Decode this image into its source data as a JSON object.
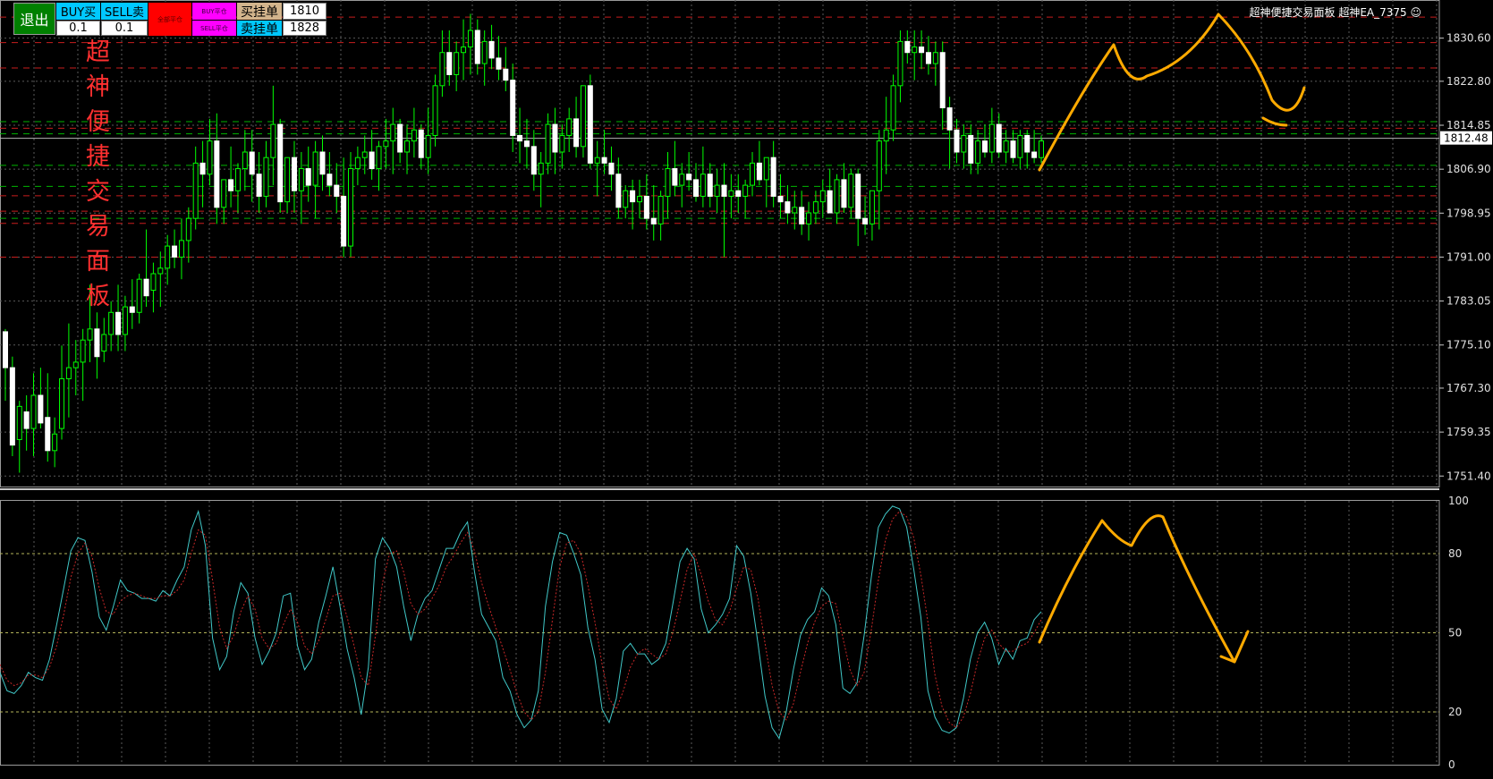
{
  "panel": {
    "exit_label": "退出",
    "buy_label": "BUY买",
    "sell_label": "SELL卖",
    "close_all_label": "全部平仓",
    "buy_close_label": "BUY平仓",
    "sell_close_label": "SELL平仓",
    "buy_pending_label": "买挂单",
    "sell_pending_label": "卖挂单",
    "buy_lot": "0.1",
    "sell_lot": "0.1",
    "buy_pending_price": "1810",
    "sell_pending_price": "1828",
    "title": "超神便捷交易面板"
  },
  "ea_title": "超神便捷交易面板 超神EA_7375",
  "colors": {
    "background": "#000000",
    "grid": "#5a5a5a",
    "candle": "#00ff00",
    "red_line": "#c81e1e",
    "green_line": "#00b400",
    "stoch_main": "#40c8c8",
    "stoch_signal": "#c82828",
    "annotation": "#ffaa00",
    "exit_button": "#008000",
    "buy_button": "#00c8ff",
    "close_all_button": "#ff0000",
    "close_side_button": "#ff00ff",
    "pending_button": "#d2b48c",
    "title_text": "#ff3030"
  },
  "chart_data": [
    {
      "type": "candlestick",
      "yticks": [
        "1830.60",
        "1822.80",
        "1814.85",
        "1806.90",
        "1798.95",
        "1791.00",
        "1783.05",
        "1775.10",
        "1767.30",
        "1759.35",
        "1751.40"
      ],
      "ylim": [
        1749.5,
        1837.5
      ],
      "current_price": "1812.48",
      "hlines_red": [
        1834.4,
        1829.8,
        1825.2,
        1814.3,
        1802.1,
        1799.3,
        1797.1,
        1791.0
      ],
      "hlines_green": [
        1815.5,
        1813.3,
        1807.6,
        1803.8,
        1798.0
      ],
      "candles": [
        [
          1777.5,
          1778,
          1765,
          1771
        ],
        [
          1771,
          1773,
          1755,
          1757
        ],
        [
          1758,
          1765,
          1752,
          1764
        ],
        [
          1763,
          1766,
          1756,
          1760
        ],
        [
          1760,
          1770,
          1755,
          1766
        ],
        [
          1766,
          1771,
          1760,
          1761
        ],
        [
          1762,
          1770,
          1754,
          1756
        ],
        [
          1756,
          1762,
          1753,
          1759
        ],
        [
          1760,
          1775,
          1758,
          1769
        ],
        [
          1769,
          1779,
          1762,
          1771
        ],
        [
          1771,
          1776,
          1766,
          1772
        ],
        [
          1772,
          1778,
          1765,
          1776
        ],
        [
          1776,
          1786,
          1772,
          1778
        ],
        [
          1778,
          1781,
          1769,
          1773
        ],
        [
          1774,
          1780,
          1772,
          1777
        ],
        [
          1777,
          1783,
          1774,
          1781
        ],
        [
          1781,
          1786,
          1774,
          1777
        ],
        [
          1777,
          1784,
          1774,
          1782
        ],
        [
          1782,
          1787,
          1778,
          1781
        ],
        [
          1781,
          1788,
          1779,
          1787
        ],
        [
          1787,
          1796,
          1782,
          1784
        ],
        [
          1785,
          1790,
          1781,
          1788
        ],
        [
          1788,
          1792,
          1782,
          1789
        ],
        [
          1789,
          1795,
          1786,
          1793
        ],
        [
          1793,
          1796,
          1789,
          1791
        ],
        [
          1791,
          1798,
          1787,
          1794
        ],
        [
          1794,
          1800,
          1790,
          1798
        ],
        [
          1798,
          1811,
          1796,
          1808
        ],
        [
          1808,
          1812,
          1800,
          1806
        ],
        [
          1806,
          1816,
          1804,
          1812
        ],
        [
          1812,
          1817,
          1797,
          1800
        ],
        [
          1800,
          1805,
          1797,
          1805
        ],
        [
          1805,
          1811,
          1800,
          1803
        ],
        [
          1803,
          1808,
          1799,
          1807
        ],
        [
          1807,
          1814,
          1803,
          1810
        ],
        [
          1810,
          1814,
          1801,
          1806
        ],
        [
          1806,
          1810,
          1799,
          1802
        ],
        [
          1802,
          1812,
          1800,
          1809
        ],
        [
          1809,
          1822,
          1804,
          1815
        ],
        [
          1815,
          1816,
          1799,
          1801
        ],
        [
          1801,
          1808,
          1799,
          1809
        ],
        [
          1809,
          1812,
          1799,
          1803
        ],
        [
          1803,
          1810,
          1797,
          1807
        ],
        [
          1807,
          1811,
          1801,
          1804
        ],
        [
          1804,
          1812,
          1798,
          1810
        ],
        [
          1810,
          1813,
          1803,
          1806
        ],
        [
          1806,
          1810,
          1802,
          1804
        ],
        [
          1804,
          1808,
          1799,
          1802
        ],
        [
          1802,
          1809,
          1791,
          1793
        ],
        [
          1793,
          1810,
          1791,
          1807
        ],
        [
          1807,
          1811,
          1804,
          1809
        ],
        [
          1809,
          1813,
          1806,
          1810
        ],
        [
          1810,
          1814,
          1805,
          1807
        ],
        [
          1807,
          1812,
          1803,
          1811
        ],
        [
          1811,
          1816,
          1807,
          1812
        ],
        [
          1812,
          1818,
          1806,
          1815
        ],
        [
          1815,
          1816,
          1808,
          1810
        ],
        [
          1810,
          1815,
          1806,
          1812
        ],
        [
          1812,
          1818,
          1809,
          1814
        ],
        [
          1814,
          1815,
          1807,
          1809
        ],
        [
          1809,
          1818,
          1806,
          1813
        ],
        [
          1813,
          1824,
          1811,
          1822
        ],
        [
          1822,
          1832,
          1820,
          1828
        ],
        [
          1828,
          1832,
          1822,
          1824
        ],
        [
          1824,
          1830,
          1821,
          1828
        ],
        [
          1828,
          1834,
          1823,
          1829
        ],
        [
          1829,
          1835,
          1824,
          1832
        ],
        [
          1832,
          1834,
          1824,
          1826
        ],
        [
          1826,
          1832,
          1822,
          1830
        ],
        [
          1830,
          1833,
          1825,
          1827
        ],
        [
          1827,
          1831,
          1823,
          1825
        ],
        [
          1825,
          1829,
          1821,
          1823
        ],
        [
          1823,
          1826,
          1810,
          1813
        ],
        [
          1813,
          1818,
          1808,
          1812
        ],
        [
          1812,
          1816,
          1807,
          1811
        ],
        [
          1811,
          1814,
          1803,
          1806
        ],
        [
          1806,
          1810,
          1800,
          1808
        ],
        [
          1808,
          1817,
          1806,
          1815
        ],
        [
          1815,
          1818,
          1806,
          1810
        ],
        [
          1810,
          1815,
          1807,
          1813
        ],
        [
          1813,
          1818,
          1810,
          1816
        ],
        [
          1816,
          1820,
          1809,
          1811
        ],
        [
          1811,
          1822,
          1809,
          1822
        ],
        [
          1822,
          1824,
          1807,
          1808
        ],
        [
          1808,
          1812,
          1802,
          1809
        ],
        [
          1809,
          1814,
          1806,
          1808
        ],
        [
          1808,
          1811,
          1803,
          1806
        ],
        [
          1806,
          1809,
          1798,
          1800
        ],
        [
          1800,
          1804,
          1798,
          1803
        ],
        [
          1803,
          1805,
          1796,
          1801
        ],
        [
          1801,
          1805,
          1798,
          1802
        ],
        [
          1802,
          1806,
          1796,
          1798
        ],
        [
          1798,
          1804,
          1794,
          1797
        ],
        [
          1797,
          1803,
          1794,
          1802
        ],
        [
          1802,
          1810,
          1798,
          1807
        ],
        [
          1807,
          1812,
          1802,
          1804
        ],
        [
          1804,
          1808,
          1800,
          1806
        ],
        [
          1806,
          1810,
          1803,
          1805
        ],
        [
          1805,
          1808,
          1801,
          1802
        ],
        [
          1802,
          1811,
          1800,
          1806
        ],
        [
          1806,
          1808,
          1800,
          1802
        ],
        [
          1802,
          1807,
          1799,
          1804
        ],
        [
          1804,
          1808,
          1791,
          1802
        ],
        [
          1802,
          1806,
          1798,
          1803
        ],
        [
          1803,
          1806,
          1799,
          1802
        ],
        [
          1802,
          1805,
          1798,
          1804
        ],
        [
          1804,
          1810,
          1802,
          1808
        ],
        [
          1808,
          1812,
          1804,
          1805
        ],
        [
          1805,
          1808,
          1800,
          1809
        ],
        [
          1809,
          1812,
          1800,
          1802
        ],
        [
          1802,
          1806,
          1798,
          1801
        ],
        [
          1801,
          1804,
          1797,
          1799
        ],
        [
          1799,
          1803,
          1796,
          1800
        ],
        [
          1800,
          1803,
          1795,
          1797
        ],
        [
          1797,
          1801,
          1794,
          1799
        ],
        [
          1799,
          1803,
          1797,
          1801
        ],
        [
          1801,
          1805,
          1798,
          1803
        ],
        [
          1803,
          1807,
          1800,
          1799
        ],
        [
          1799,
          1806,
          1797,
          1805
        ],
        [
          1805,
          1808,
          1799,
          1800
        ],
        [
          1800,
          1807,
          1798,
          1806
        ],
        [
          1806,
          1807,
          1793,
          1798
        ],
        [
          1798,
          1802,
          1795,
          1797
        ],
        [
          1797,
          1802,
          1794,
          1803
        ],
        [
          1803,
          1814,
          1796,
          1812
        ],
        [
          1812,
          1820,
          1806,
          1814
        ],
        [
          1814,
          1824,
          1812,
          1822
        ],
        [
          1822,
          1832,
          1819,
          1830
        ],
        [
          1830,
          1832,
          1826,
          1828
        ],
        [
          1828,
          1832,
          1823,
          1829
        ],
        [
          1829,
          1832,
          1825,
          1828
        ],
        [
          1828,
          1831,
          1824,
          1826
        ],
        [
          1826,
          1830,
          1822,
          1828
        ],
        [
          1828,
          1830,
          1814,
          1818
        ],
        [
          1818,
          1820,
          1807,
          1814
        ],
        [
          1814,
          1816,
          1808,
          1810
        ],
        [
          1810,
          1815,
          1807,
          1813
        ],
        [
          1813,
          1815,
          1806,
          1808
        ],
        [
          1808,
          1814,
          1806,
          1812
        ],
        [
          1812,
          1815,
          1809,
          1810
        ],
        [
          1810,
          1818,
          1808,
          1815
        ],
        [
          1815,
          1817,
          1809,
          1810
        ],
        [
          1810,
          1814,
          1808,
          1812
        ],
        [
          1812,
          1814,
          1808,
          1809
        ],
        [
          1809,
          1814,
          1807,
          1813
        ],
        [
          1813,
          1814,
          1807,
          1810
        ],
        [
          1810,
          1814,
          1808,
          1809
        ],
        [
          1809,
          1813,
          1808,
          1812
        ]
      ]
    },
    {
      "type": "line",
      "yticks": [
        "100",
        "80",
        "50",
        "20",
        "0"
      ],
      "ylim": [
        0,
        100
      ],
      "levels": [
        80,
        50,
        20
      ],
      "series": [
        {
          "values": [
            35,
            28,
            27,
            30,
            35,
            33,
            32,
            40,
            53,
            67,
            81,
            86,
            85,
            73,
            56,
            51,
            60,
            70,
            66,
            65,
            63,
            63,
            62,
            66,
            64,
            70,
            75,
            89,
            96,
            83,
            48,
            36,
            41,
            58,
            69,
            65,
            48,
            38,
            43,
            50,
            64,
            65,
            45,
            36,
            40,
            54,
            64,
            75,
            60,
            44,
            33,
            19,
            37,
            78,
            86,
            82,
            75,
            60,
            47,
            57,
            63,
            66,
            74,
            82,
            82,
            88,
            92,
            73,
            57,
            52,
            47,
            33,
            28,
            19,
            14,
            17,
            28,
            60,
            77,
            88,
            87,
            80,
            72,
            52,
            40,
            21,
            16,
            25,
            43,
            46,
            42,
            42,
            38,
            40,
            46,
            61,
            77,
            82,
            78,
            59,
            50,
            53,
            57,
            63,
            83,
            79,
            65,
            46,
            26,
            14,
            10,
            20,
            36,
            49,
            55,
            58,
            67,
            64,
            53,
            29,
            27,
            31,
            49,
            71,
            90,
            95,
            98,
            97,
            90,
            74,
            56,
            28,
            18,
            13,
            12,
            14,
            25,
            40,
            50,
            54,
            48,
            38,
            44,
            40,
            47,
            48,
            55,
            58
          ]
        },
        {
          "values": [
            38,
            32,
            30,
            31,
            34,
            34,
            33,
            37,
            45,
            57,
            71,
            80,
            84,
            79,
            67,
            58,
            57,
            62,
            64,
            65,
            64,
            63,
            63,
            64,
            64,
            66,
            70,
            80,
            89,
            87,
            70,
            52,
            44,
            49,
            58,
            64,
            59,
            48,
            44,
            46,
            53,
            59,
            54,
            45,
            42,
            47,
            55,
            64,
            65,
            56,
            45,
            33,
            30,
            49,
            69,
            80,
            81,
            73,
            61,
            57,
            59,
            63,
            68,
            75,
            79,
            84,
            88,
            81,
            69,
            60,
            52,
            44,
            36,
            27,
            20,
            17,
            20,
            35,
            55,
            75,
            84,
            85,
            80,
            68,
            54,
            38,
            25,
            21,
            28,
            37,
            42,
            44,
            42,
            40,
            42,
            50,
            62,
            74,
            80,
            72,
            62,
            55,
            53,
            58,
            67,
            75,
            74,
            63,
            46,
            30,
            20,
            17,
            23,
            35,
            46,
            54,
            60,
            62,
            61,
            48,
            36,
            30,
            35,
            51,
            70,
            85,
            93,
            96,
            94,
            86,
            72,
            54,
            34,
            22,
            16,
            14,
            18,
            27,
            39,
            48,
            51,
            46,
            43,
            43,
            45,
            46,
            50,
            55
          ]
        }
      ]
    }
  ]
}
